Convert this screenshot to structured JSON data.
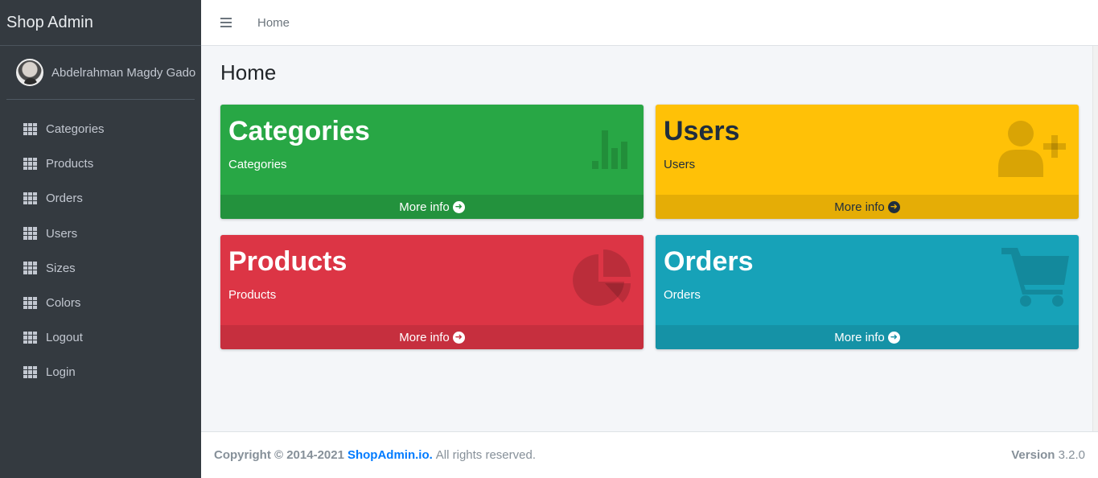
{
  "brand": "Shop Admin",
  "user": {
    "name": "Abdelrahman Magdy Gado"
  },
  "sidebar": {
    "items": [
      {
        "label": "Categories",
        "icon": "th-icon"
      },
      {
        "label": "Products",
        "icon": "th-icon"
      },
      {
        "label": "Orders",
        "icon": "th-icon"
      },
      {
        "label": "Users",
        "icon": "th-icon"
      },
      {
        "label": "Sizes",
        "icon": "th-icon"
      },
      {
        "label": "Colors",
        "icon": "th-icon"
      },
      {
        "label": "Logout",
        "icon": "th-icon"
      },
      {
        "label": "Login",
        "icon": "th-icon"
      }
    ]
  },
  "topbar": {
    "home_label": "Home"
  },
  "page": {
    "title": "Home"
  },
  "boxes": [
    {
      "title": "Categories",
      "subtitle": "Categories",
      "footer": "More info",
      "color": "#28a745",
      "icon": "bar-chart-icon"
    },
    {
      "title": "Users",
      "subtitle": "Users",
      "footer": "More info",
      "color": "#ffc107",
      "icon": "user-plus-icon"
    },
    {
      "title": "Products",
      "subtitle": "Products",
      "footer": "More info",
      "color": "#dc3545",
      "icon": "pie-chart-icon"
    },
    {
      "title": "Orders",
      "subtitle": "Orders",
      "footer": "More info",
      "color": "#17a2b8",
      "icon": "shopping-cart-icon"
    }
  ],
  "footer": {
    "copyright": "Copyright © 2014-2021",
    "link": "ShopAdmin.io.",
    "rest": "All rights reserved.",
    "version_label": "Version",
    "version_value": "3.2.0"
  }
}
